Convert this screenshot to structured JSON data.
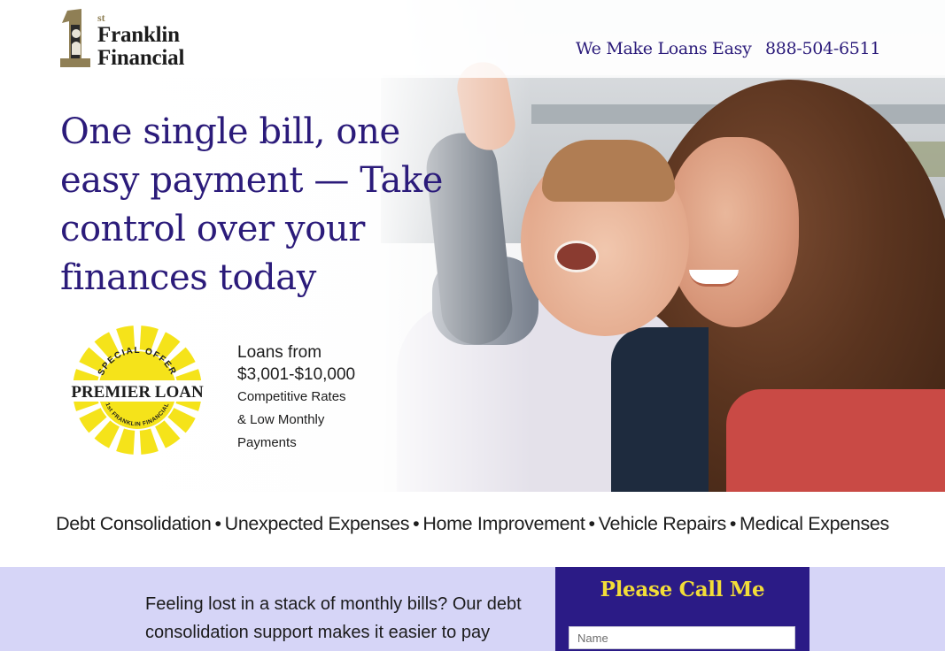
{
  "header": {
    "logo": {
      "superscript": "st",
      "line1": "Franklin",
      "line2": "Financial"
    },
    "tagline": "We Make Loans Easy",
    "phone": "888-504-6511"
  },
  "hero": {
    "headline": "One single bill, one easy payment — Take control over your finances today",
    "badge": {
      "arc_text": "SPECIAL OFFER",
      "main_text": "PREMIER LOAN",
      "sub_text": "1st FRANKLIN FINANCIAL",
      "color": "#f5e31a"
    },
    "offer": {
      "line1": "Loans from",
      "line2": "$3,001-$10,000",
      "line3": "Competitive Rates",
      "line4": "& Low Monthly",
      "line5": "Payments"
    }
  },
  "categories": {
    "items": [
      "Debt Consolidation",
      "Unexpected Expenses",
      "Home Improvement",
      "Vehicle Repairs",
      "Medical Expenses"
    ],
    "separator": "•"
  },
  "lower": {
    "copy": "Feeling lost in a stack of monthly bills? Our debt consolidation support makes it easier to pay",
    "call_box": {
      "title": "Please Call Me",
      "name_placeholder": "Name"
    }
  },
  "colors": {
    "brand_purple": "#2b1b7a",
    "call_box_bg": "#2b1b86",
    "call_title": "#f2dd38",
    "lower_bg": "#d6d5f7",
    "logo_gold": "#8f7f55"
  }
}
